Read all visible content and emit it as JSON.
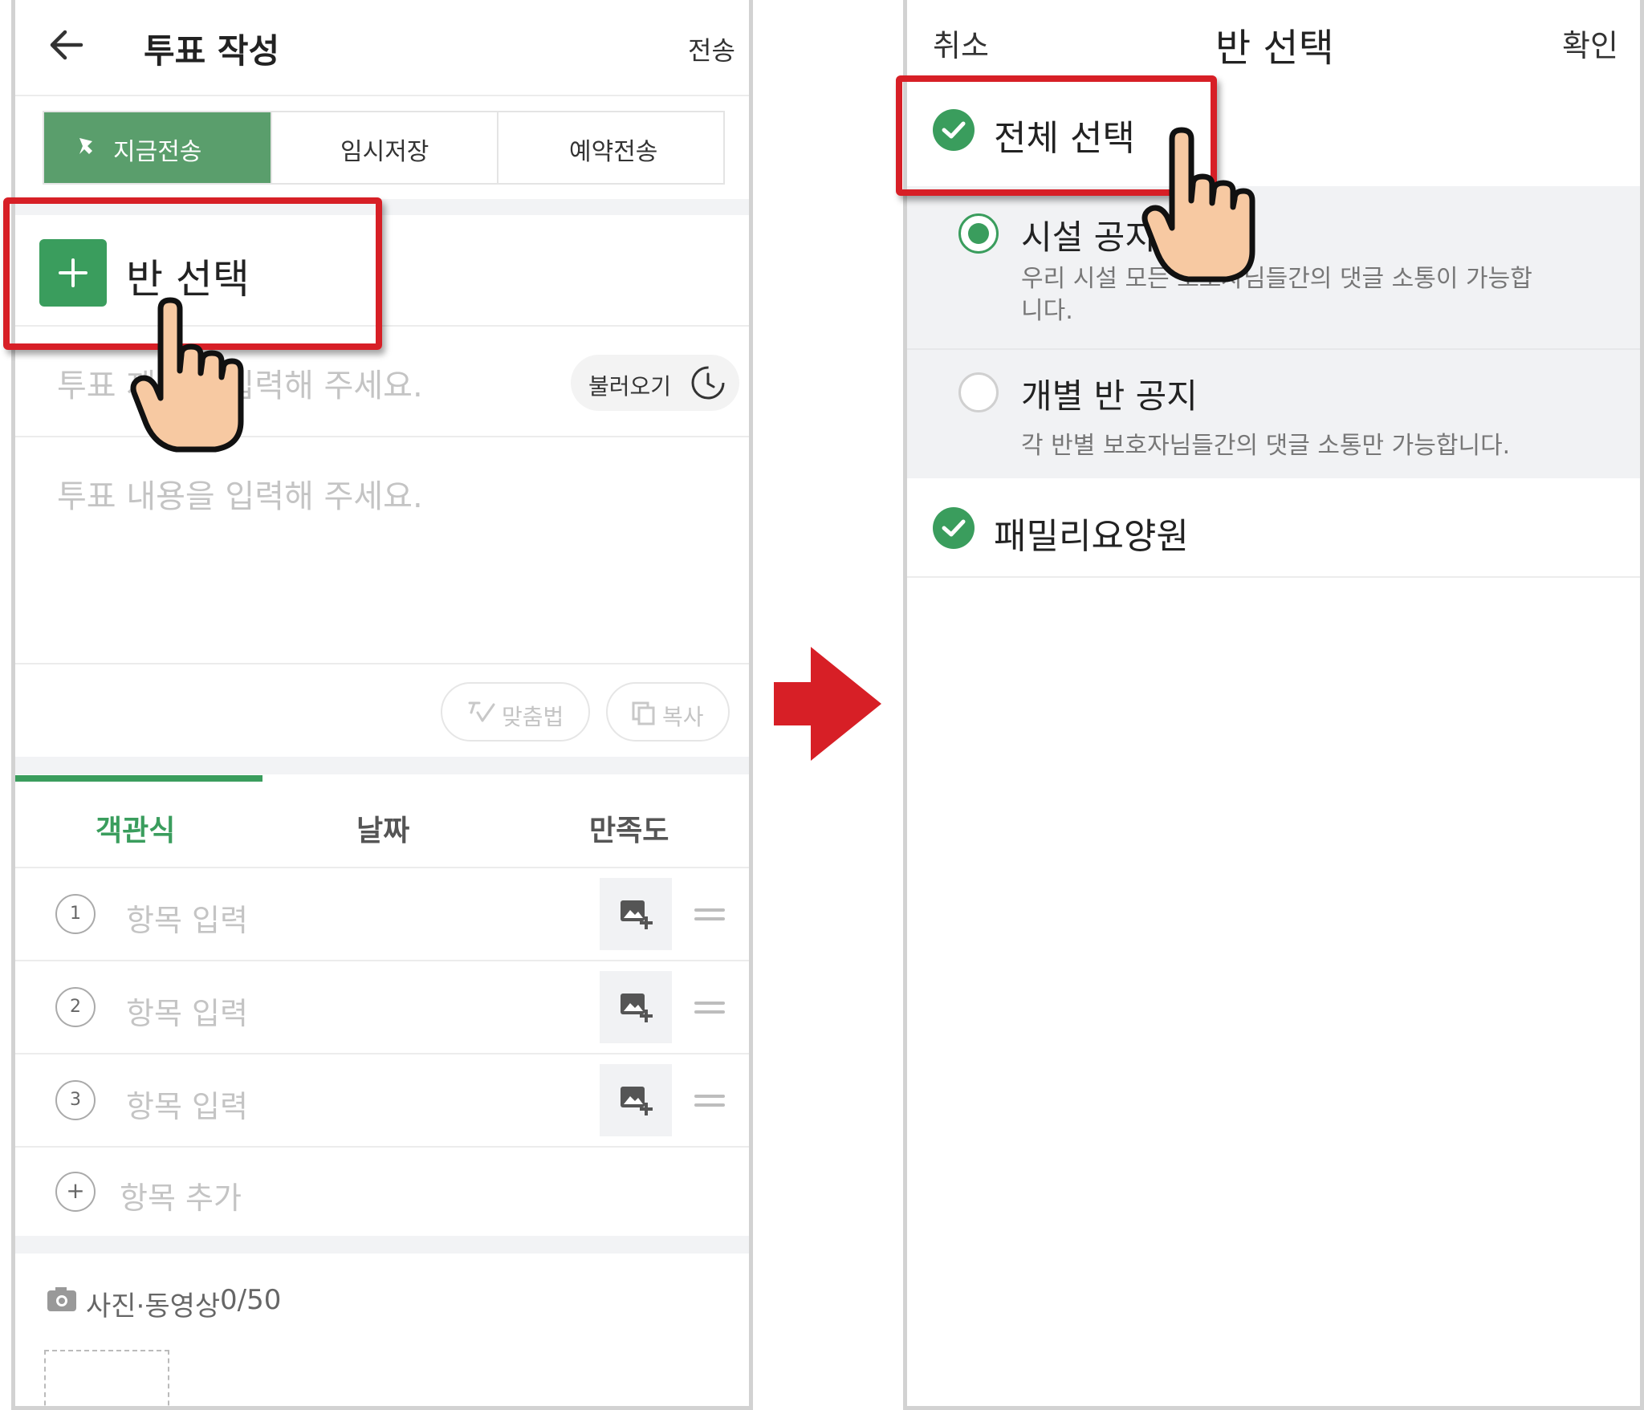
{
  "left": {
    "header": {
      "title": "투표 작성",
      "send_label": "전송"
    },
    "send_tabs": {
      "now": "지금전송",
      "draft": "임시저장",
      "scheduled": "예약전송"
    },
    "class_select_label": "반 선택",
    "title_placeholder": "투표 제목을 입력해 주세요.",
    "load_label": "불러오기",
    "content_placeholder": "투표 내용을 입력해 주세요.",
    "spellcheck_label": "맞춤법",
    "copy_label": "복사",
    "vote_types": {
      "choice": "객관식",
      "date": "날짜",
      "satisfaction": "만족도"
    },
    "options": [
      {
        "num": "1",
        "placeholder": "항목 입력"
      },
      {
        "num": "2",
        "placeholder": "항목 입력"
      },
      {
        "num": "3",
        "placeholder": "항목 입력"
      }
    ],
    "add_option_label": "항목 추가",
    "media_label": "사진·동영상",
    "media_count": "0/50"
  },
  "right": {
    "header": {
      "cancel": "취소",
      "title": "반 선택",
      "confirm": "확인"
    },
    "select_all_label": "전체 선택",
    "notice_options": [
      {
        "title": "시설 공지",
        "desc": "우리 시설 모든 보호자님들간의 댓글 소통이 가능합니다.",
        "selected": true
      },
      {
        "title": "개별 반 공지",
        "desc": "각 반별 보호자님들간의 댓글 소통만 가능합니다.",
        "selected": false
      }
    ],
    "facility_name": "패밀리요양원"
  },
  "colors": {
    "accent_green": "#3a9d5d",
    "highlight_red": "#d71f26",
    "arrow_red": "#d71f26"
  },
  "icons": [
    "back-arrow-icon",
    "pin-icon",
    "plus-icon",
    "clock-icon",
    "spellcheck-icon",
    "copy-icon",
    "image-add-icon",
    "drag-handle-icon",
    "camera-icon",
    "checkmark-icon",
    "pointing-hand-icon",
    "right-arrow-icon"
  ]
}
